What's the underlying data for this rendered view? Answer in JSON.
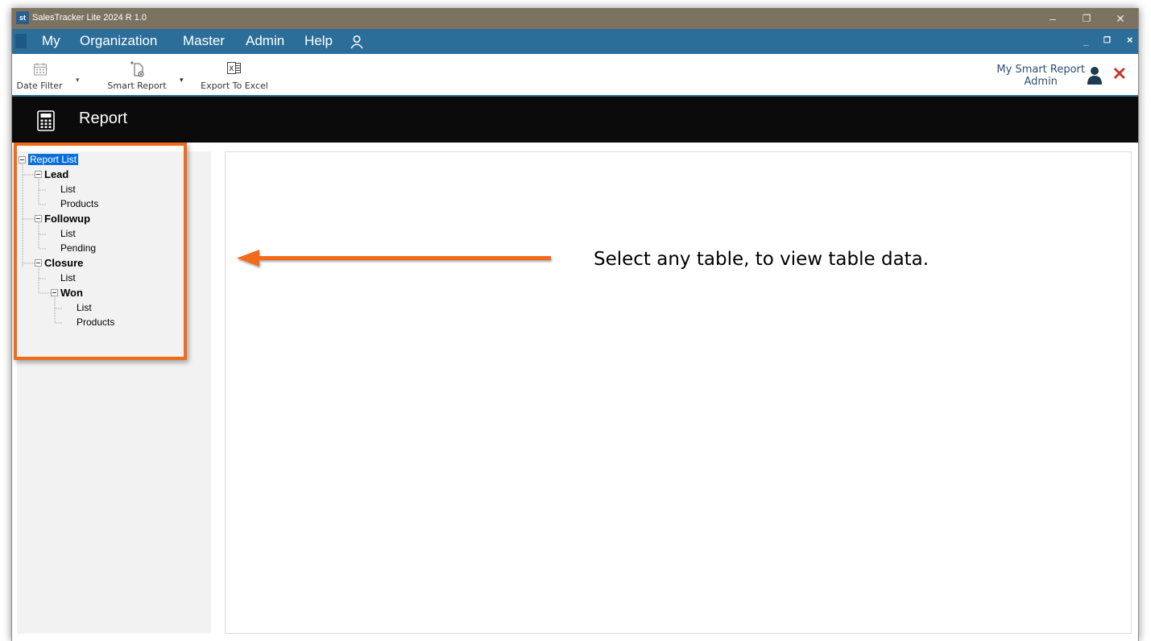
{
  "window": {
    "logo": "st",
    "title": "SalesTracker Lite 2024 R 1.0",
    "controls": {
      "minimize": "–",
      "restore": "❐",
      "close": "✕"
    }
  },
  "menu": {
    "items": [
      "My",
      "Organization",
      "Master",
      "Admin",
      "Help"
    ],
    "user_icon": "person-icon",
    "mdi_controls": {
      "minimize": "_",
      "restore": "❐",
      "close": "×"
    }
  },
  "toolbar": {
    "date_filter_label": "Date Filter",
    "smart_report_label": "Smart Report",
    "export_label": "Export To Excel",
    "profile_title": "My Smart Report",
    "profile_user": "Admin",
    "close_label": "✕"
  },
  "page": {
    "title": "Report"
  },
  "tree": {
    "root": "Report List",
    "lead": "Lead",
    "lead_list": "List",
    "lead_products": "Products",
    "followup": "Followup",
    "followup_list": "List",
    "followup_pending": "Pending",
    "closure": "Closure",
    "closure_list": "List",
    "won": "Won",
    "won_list": "List",
    "won_products": "Products"
  },
  "annotation": {
    "hint": "Select any table, to view table data.",
    "accent_color": "#f26b1a"
  },
  "colors": {
    "titlebar": "#7b7360",
    "menubar": "#2b6e99",
    "header": "#0b0b0b",
    "selection": "#0a6fd8"
  }
}
